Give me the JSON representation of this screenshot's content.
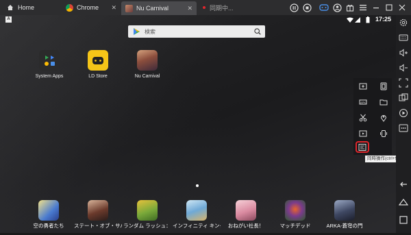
{
  "tabs": [
    {
      "label": "Home",
      "icon": "home-icon"
    },
    {
      "label": "Chrome",
      "icon": "chrome-icon"
    },
    {
      "label": "Nu Carnival",
      "icon": "nu-carnival-icon"
    },
    {
      "label": "同期中...",
      "icon": "record-icon"
    }
  ],
  "status": {
    "time": "17:25"
  },
  "search": {
    "placeholder": "検索"
  },
  "apps": [
    {
      "label": "System Apps"
    },
    {
      "label": "LD Store"
    },
    {
      "label": "Nu Carnival"
    }
  ],
  "dock": [
    {
      "label": "空の勇者たち"
    },
    {
      "label": "ステート・オブ・サバイバル"
    },
    {
      "label": "ランダム ラッシュ：ロワイヤル"
    },
    {
      "label": "インフィニティ キングダム：諸王の"
    },
    {
      "label": "おねがい社長！"
    },
    {
      "label": "マッチデッド"
    },
    {
      "label": "ARKA-蒼穹の門"
    }
  ],
  "tooltip": {
    "text": "同時操作(ctrl+9)"
  },
  "colors": {
    "highlight": "#e0262c",
    "titlebar": "#2d2d2f"
  }
}
